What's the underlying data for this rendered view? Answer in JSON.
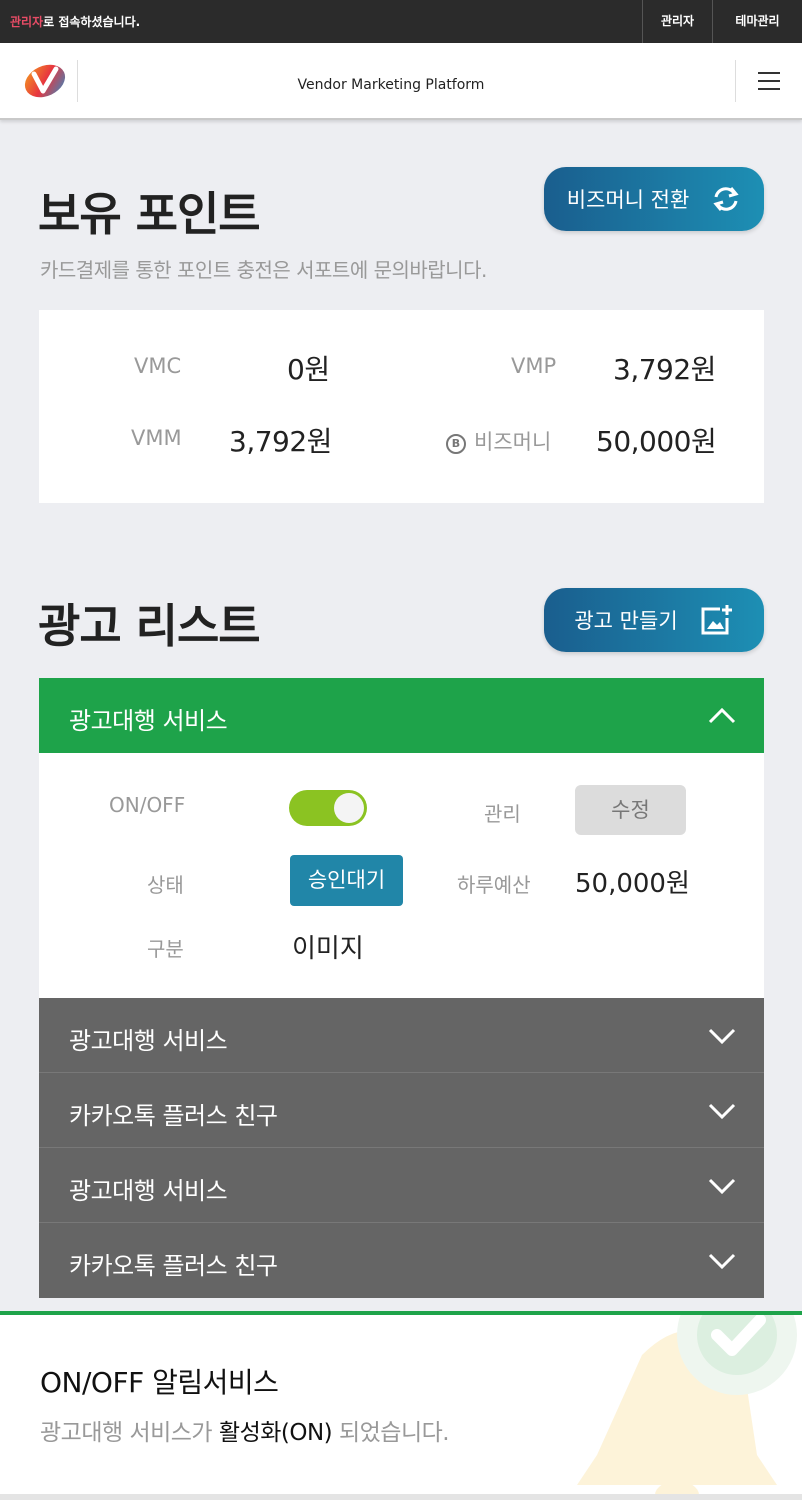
{
  "adminbar": {
    "highlight": "관리자",
    "message": "로 접속하셨습니다.",
    "links": [
      "관리자",
      "테마관리"
    ]
  },
  "header": {
    "title": "Vendor Marketing Platform"
  },
  "points_section": {
    "title": "보유 포인트",
    "subtitle": "카드결제를 통한 포인트 충전은 서포트에 문의바랍니다.",
    "convert_button": "비즈머니 전환",
    "items": [
      {
        "label": "VMC",
        "value": "0원"
      },
      {
        "label": "VMP",
        "value": "3,792원"
      },
      {
        "label": "VMM",
        "value": "3,792원"
      },
      {
        "label": "비즈머니",
        "value": "50,000원"
      }
    ]
  },
  "ad_section": {
    "title": "광고 리스트",
    "create_button": "광고 만들기",
    "open_item": {
      "title": "광고대행 서비스",
      "fields": {
        "onoff_label": "ON/OFF",
        "manage_label": "관리",
        "edit_button": "수정",
        "status_label": "상태",
        "status_value": "승인대기",
        "budget_label": "하루예산",
        "budget_value": "50,000원",
        "type_label": "구분",
        "type_value": "이미지"
      },
      "toggle_on": true
    },
    "collapsed_items": [
      "광고대행 서비스",
      "카카오톡 플러스 친구",
      "광고대행 서비스",
      "카카오톡 플러스 친구"
    ]
  },
  "notice": {
    "title": "ON/OFF 알림서비스",
    "msg_prefix": "광고대행 서비스가 ",
    "msg_strong": "활성화(ON)",
    "msg_suffix": " 되었습니다."
  },
  "colors": {
    "green": "#1ea34a",
    "toggle": "#8bc322",
    "badge": "#2186a8",
    "collapsed_row": "#656565"
  }
}
